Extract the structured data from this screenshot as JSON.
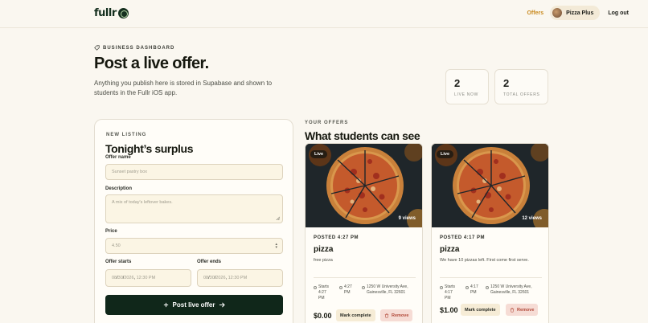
{
  "header": {
    "logo_text": "fullr",
    "nav_offers": "Offers",
    "user_name": "Pizza Plus",
    "logout": "Log out"
  },
  "hero": {
    "kicker": "BUSINESS DASHBOARD",
    "title": "Post a live offer.",
    "subtitle": "Anything you publish here is stored in Supabase and shown to students in the Fullr iOS app."
  },
  "stats": [
    {
      "value": "2",
      "label": "LIVE NOW"
    },
    {
      "value": "2",
      "label": "TOTAL OFFERS"
    }
  ],
  "form": {
    "kicker": "NEW LISTING",
    "title": "Tonight’s surplus",
    "offer_name_label": "Offer name",
    "offer_name_placeholder": "Sunset pastry box",
    "description_label": "Description",
    "description_placeholder": "A mix of today's leftover bakes.",
    "price_label": "Price",
    "price_placeholder": "4.50",
    "starts_label": "Offer starts",
    "ends_label": "Offer ends",
    "date_parts": {
      "mm": "08",
      "dd": "30",
      "yyyy": "2026",
      "time": "12:30 PM"
    },
    "submit_label": "Post live offer"
  },
  "offers_section": {
    "kicker": "YOUR OFFERS",
    "title": "What students can see"
  },
  "offers": [
    {
      "status": "Live",
      "views": "9 views",
      "posted": "POSTED 4:27 PM",
      "name": "pizza",
      "description": "free pizza",
      "starts_label": "Starts",
      "starts_time": "4:27 PM",
      "ends_time": "4:27 PM",
      "address": "1250 W University Ave, Gainesville, FL 32601",
      "price": "$0.00",
      "mark_label": "Mark complete",
      "remove_label": "Remove"
    },
    {
      "status": "Live",
      "views": "12 views",
      "posted": "POSTED 4:17 PM",
      "name": "pizza",
      "description": "We have 10 pizzas left. First come first serve.",
      "starts_label": "Starts",
      "starts_time": "4:17 PM",
      "ends_time": "4:17 PM",
      "address": "1250 W University Ave, Gainesville, FL 32601",
      "price": "$1.00",
      "mark_label": "Mark complete",
      "remove_label": "Remove"
    }
  ],
  "icons": {
    "logo": "logo-mark-icon",
    "kicker": "tag-icon",
    "plus": "plus-icon",
    "arrow": "arrow-right-icon",
    "clock": "clock-icon",
    "pin": "location-pin-icon",
    "trash": "trash-icon"
  },
  "colors": {
    "background": "#faf7f0",
    "primary": "#10271a",
    "accent": "#c98a1e",
    "remove": "#b24a3a"
  }
}
